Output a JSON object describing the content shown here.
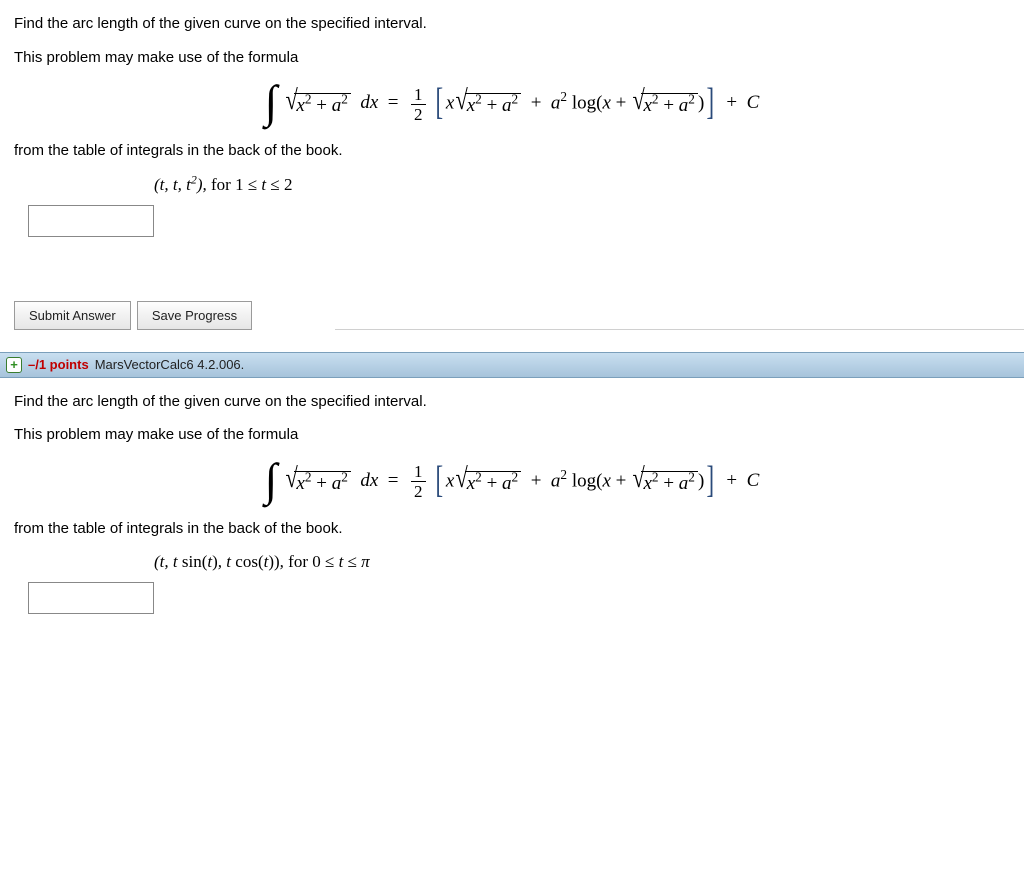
{
  "problem1": {
    "prompt": "Find the arc length of the given curve on the specified interval.",
    "hint_intro": "This problem may make use of the formula",
    "hint_outro": "from the table of integrals in the back of the book.",
    "buttons": {
      "submit": "Submit Answer",
      "save": "Save Progress"
    },
    "curve_html": "(<i>t</i>, <i>t</i>, <i>t</i><sup>2</sup>), <span class='up'>for 1 ≤ </span><i>t</i><span class='up'> ≤ 2</span>",
    "answer": ""
  },
  "q_header": {
    "points": "–/1 points",
    "source": "MarsVectorCalc6 4.2.006."
  },
  "problem2": {
    "prompt": "Find the arc length of the given curve on the specified interval.",
    "hint_intro": "This problem may make use of the formula",
    "hint_outro": "from the table of integrals in the back of the book.",
    "curve_html": "(<i>t</i>, <i>t</i> <span class='up'>sin(</span><i>t</i><span class='up'>)</span>, <i>t</i> <span class='up'>cos(</span><i>t</i><span class='up'>))</span>, <span class='up'>for 0 ≤ </span><i>t</i><span class='up'> ≤ </span><i>π</i>",
    "answer": ""
  },
  "formula": {
    "note": "∫ √(x² + a²) dx = (1/2)[ x√(x² + a²) + a² log(x + √(x² + a²)) ] + C"
  }
}
